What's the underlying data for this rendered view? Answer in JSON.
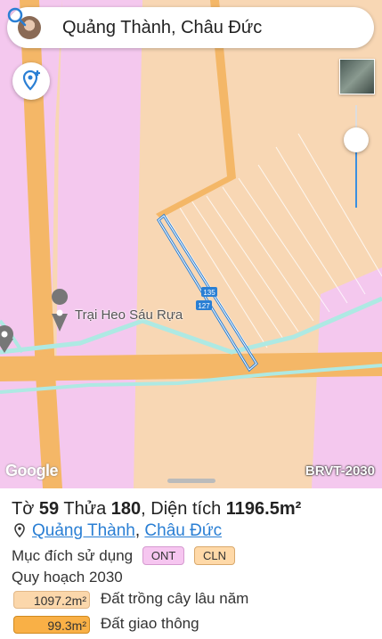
{
  "search": {
    "query": "Quảng Thành, Châu Đức"
  },
  "map": {
    "poi_label": "Trại Heo Sáu Rựa",
    "road_labels": [
      "135",
      "127"
    ],
    "attribution": "Google",
    "plan_tag": "BRVT-2030",
    "colors": {
      "residential": "#f4c8ee",
      "agricultural": "#f8d7b4",
      "road": "#f4b767",
      "water": "#aee9e3"
    }
  },
  "parcel": {
    "sheet_label": "Tờ",
    "sheet_no": "59",
    "plot_label": "Thửa",
    "plot_no": "180",
    "area_label": "Diện tích",
    "area_value": "1196.5m²",
    "ward": "Quảng Thành",
    "district": "Châu Đức",
    "purpose_label": "Mục đích sử dụng",
    "purpose_codes": [
      "ONT",
      "CLN"
    ],
    "plan_label": "Quy hoạch 2030",
    "plan_rows": [
      {
        "area": "1097.2m²",
        "name": "Đất trồng cây lâu năm",
        "color": "#fbd7ab"
      },
      {
        "area": "99.3m²",
        "name": "Đất giao thông",
        "color": "#f9b046"
      }
    ]
  }
}
